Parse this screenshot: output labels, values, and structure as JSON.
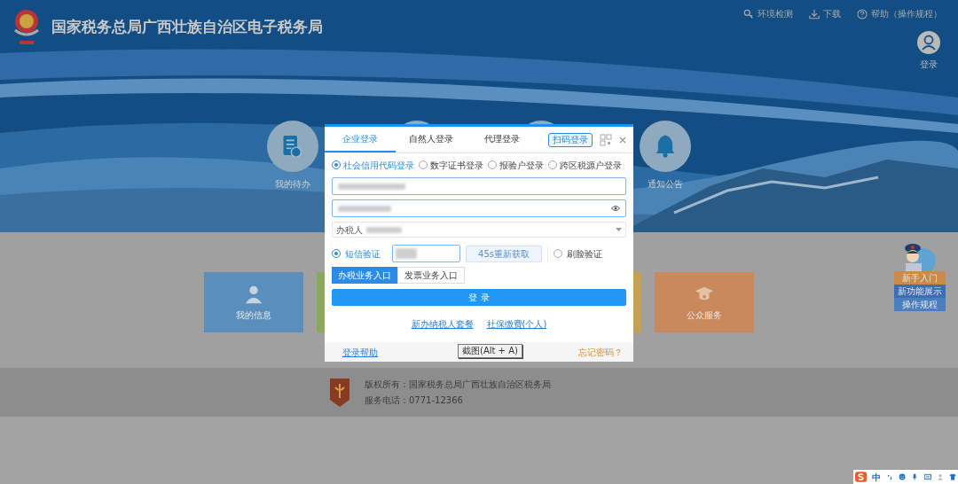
{
  "header": {
    "title": "国家税务总局广西壮族自治区电子税务局",
    "links": [
      {
        "kind": "key",
        "label": "环境检测"
      },
      {
        "kind": "download",
        "label": "下载"
      },
      {
        "kind": "help",
        "label": "帮助（操作规程）"
      }
    ],
    "user_label": "登录"
  },
  "quick_icons": [
    {
      "kind": "todo",
      "label": "我的待办"
    },
    {
      "kind": "blank"
    },
    {
      "kind": "blank"
    },
    {
      "kind": "bell",
      "label": "通知公告"
    }
  ],
  "cards": [
    {
      "label": "我的信息",
      "color": "#5a8fbd"
    },
    {
      "color": "#88a95a"
    },
    {
      "color": "#c6a24c"
    },
    {
      "label": "公众服务",
      "color": "#c9895c"
    }
  ],
  "side_widget": {
    "buttons": [
      {
        "label": "新手入门",
        "color": "#c98a4a"
      },
      {
        "label": "新功能展示",
        "color": "#3f6db3"
      },
      {
        "label": "操作规程",
        "color": "#4a7fbf"
      }
    ]
  },
  "footer": {
    "copyright": "版权所有：国家税务总局广西壮族自治区税务局",
    "phone": "服务电话：0771-12366"
  },
  "login_dialog": {
    "tabs": [
      {
        "label": "企业登录",
        "selected": true
      },
      {
        "label": "自然人登录",
        "selected": false
      },
      {
        "label": "代理登录",
        "selected": false
      }
    ],
    "scan_button": "扫码登录",
    "login_types": [
      {
        "label": "社会信用代码登录",
        "selected": true
      },
      {
        "label": "数字证书登录",
        "selected": false
      },
      {
        "label": "报验户登录",
        "selected": false
      },
      {
        "label": "跨区税源户登录",
        "selected": false
      }
    ],
    "agent_label": "办税人",
    "verify_methods": [
      {
        "label": "短信验证",
        "selected": true
      },
      {
        "label": "刷脸验证",
        "selected": false
      }
    ],
    "resend_button": "45s重新获取",
    "entries": [
      {
        "label": "办税业务入口",
        "selected": true
      },
      {
        "label": "发票业务入口",
        "selected": false
      }
    ],
    "login_button": "登 录",
    "links": [
      "新办纳税人套餐",
      "社保缴费(个人)"
    ],
    "help_link": "登录帮助",
    "forgot_link": "忘记密码？",
    "tooltip": "截图(Alt + A)"
  },
  "ime_toolbar": {
    "mode": "中"
  }
}
